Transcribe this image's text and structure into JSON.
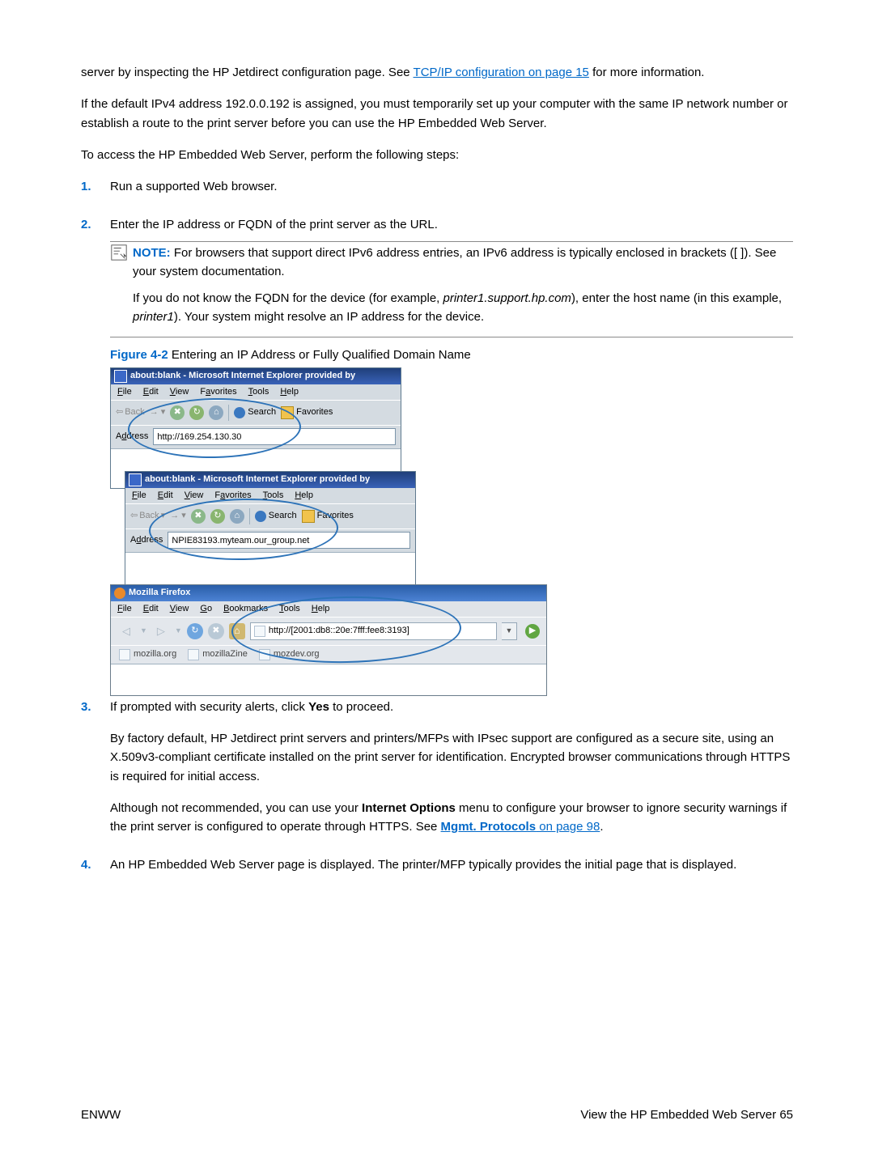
{
  "para1_a": "server by inspecting the HP Jetdirect configuration page. See ",
  "para1_link": "TCP/IP configuration on page 15",
  "para1_b": " for more information.",
  "para2": "If the default IPv4 address 192.0.0.192 is assigned, you must temporarily set up your computer with the same IP network number or establish a route to the print server before you can use the HP Embedded Web Server.",
  "para3": "To access the HP Embedded Web Server, perform the following steps:",
  "step1_num": "1.",
  "step1": "Run a supported Web browser.",
  "step2_num": "2.",
  "step2": "Enter the IP address or FQDN of the print server as the URL.",
  "note_kw": "NOTE:",
  "note_text": "   For browsers that support direct IPv6 address entries, an IPv6 address is typically enclosed in brackets ([ ]). See your system documentation.",
  "note_p2a": "If you do not know the FQDN for the device (for example, ",
  "note_p2_em1": "printer1.support.hp.com",
  "note_p2b": "), enter the host name (in this example, ",
  "note_p2_em2": "printer1",
  "note_p2c": "). Your system might resolve an IP address for the device.",
  "fig_label": "Figure 4-2",
  "fig_caption": "  Entering an IP Address or Fully Qualified Domain Name",
  "browser_a": {
    "title": "about:blank - Microsoft Internet Explorer provided by",
    "menu": {
      "file": "File",
      "edit": "Edit",
      "view": "View",
      "fav": "Favorites",
      "tools": "Tools",
      "help": "Help"
    },
    "back": "Back",
    "search": "Search",
    "favorites": "Favorites",
    "addr_label": "Address",
    "addr_value": "http://169.254.130.30"
  },
  "browser_b": {
    "title": "about:blank - Microsoft Internet Explorer provided by",
    "menu": {
      "file": "File",
      "edit": "Edit",
      "view": "View",
      "fav": "Favorites",
      "tools": "Tools",
      "help": "Help"
    },
    "back": "Back",
    "search": "Search",
    "favorites": "Favorites",
    "addr_label": "Address",
    "addr_value": "NPIE83193.myteam.our_group.net"
  },
  "browser_c": {
    "title": "Mozilla Firefox",
    "menu": {
      "file": "File",
      "edit": "Edit",
      "view": "View",
      "go": "Go",
      "bookmarks": "Bookmarks",
      "tools": "Tools",
      "help": "Help"
    },
    "addr_value": "http://[2001:db8::20e:7fff:fee8:3193]",
    "bm1": "mozilla.org",
    "bm2": "mozillaZine",
    "bm3": "mozdev.org"
  },
  "step3_num": "3.",
  "step3a": "If prompted with security alerts, click ",
  "step3_bold": "Yes",
  "step3b": " to proceed.",
  "step3_p2": "By factory default, HP Jetdirect print servers and printers/MFPs with IPsec support are configured as a secure site, using an X.509v3-compliant certificate installed on the print server for identification. Encrypted browser communications through HTTPS is required for initial access.",
  "step3_p3a": "Although not recommended, you can use your ",
  "step3_p3_bold": "Internet Options",
  "step3_p3b": " menu to configure your browser to ignore security warnings if the print server is configured to operate through HTTPS. See ",
  "step3_link": "Mgmt. Protocols",
  "step3_link_after": " on page 98",
  "step3_p3c": ".",
  "step4_num": "4.",
  "step4": "An HP Embedded Web Server page is displayed. The printer/MFP typically provides the initial page that is displayed.",
  "footer_left": "ENWW",
  "footer_right": "View the HP Embedded Web Server    65"
}
